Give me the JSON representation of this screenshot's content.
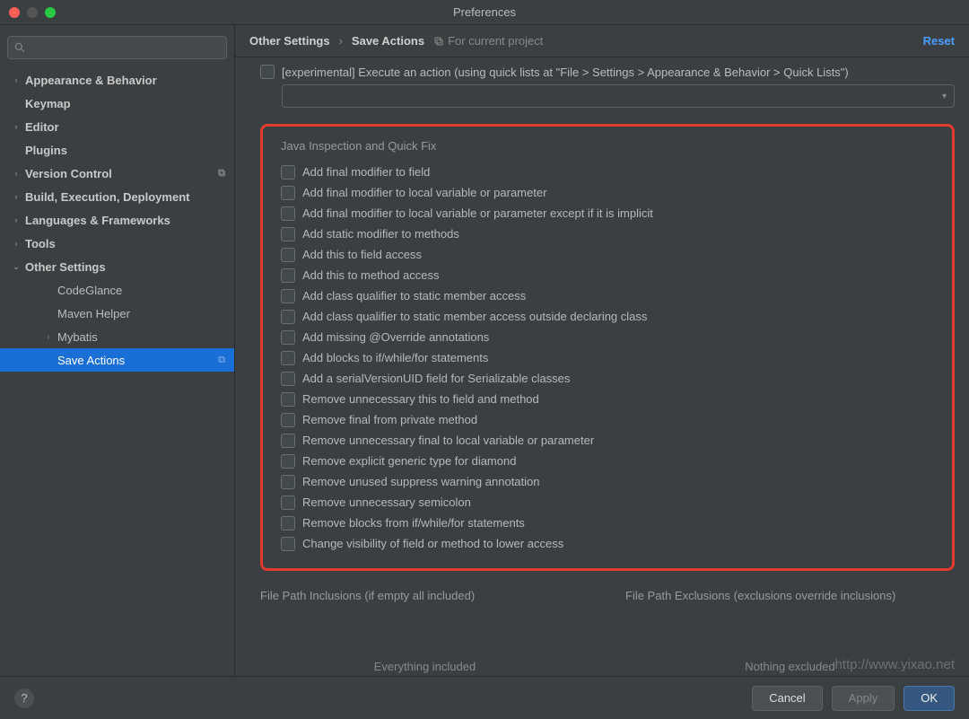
{
  "window": {
    "title": "Preferences"
  },
  "search": {
    "placeholder": ""
  },
  "sidebar": {
    "items": [
      {
        "label": "Appearance & Behavior",
        "bold": true,
        "chev": "›"
      },
      {
        "label": "Keymap",
        "bold": true,
        "chev": ""
      },
      {
        "label": "Editor",
        "bold": true,
        "chev": "›"
      },
      {
        "label": "Plugins",
        "bold": true,
        "chev": ""
      },
      {
        "label": "Version Control",
        "bold": true,
        "chev": "›",
        "proj": true
      },
      {
        "label": "Build, Execution, Deployment",
        "bold": true,
        "chev": "›"
      },
      {
        "label": "Languages & Frameworks",
        "bold": true,
        "chev": "›"
      },
      {
        "label": "Tools",
        "bold": true,
        "chev": "›"
      },
      {
        "label": "Other Settings",
        "bold": true,
        "chev": "⌄"
      },
      {
        "label": "CodeGlance",
        "indent": 2
      },
      {
        "label": "Maven Helper",
        "indent": 2
      },
      {
        "label": "Mybatis",
        "indent": 2,
        "chev": "›"
      },
      {
        "label": "Save Actions",
        "indent": 2,
        "selected": true,
        "proj": true
      }
    ]
  },
  "breadcrumb": {
    "a": "Other Settings",
    "sep": "›",
    "b": "Save Actions",
    "for_project": "For current project",
    "reset": "Reset"
  },
  "experimental": {
    "label": "[experimental] Execute an action (using quick lists at \"File > Settings > Appearance & Behavior > Quick Lists\")"
  },
  "group": {
    "title": "Java Inspection and Quick Fix",
    "options": [
      "Add final modifier to field",
      "Add final modifier to local variable or parameter",
      "Add final modifier to local variable or parameter except if it is implicit",
      "Add static modifier to methods",
      "Add this to field access",
      "Add this to method access",
      "Add class qualifier to static member access",
      "Add class qualifier to static member access outside declaring class",
      "Add missing @Override annotations",
      "Add blocks to if/while/for statements",
      "Add a serialVersionUID field for Serializable classes",
      "Remove unnecessary this to field and method",
      "Remove final from private method",
      "Remove unnecessary final to local variable or parameter",
      "Remove explicit generic type for diamond",
      "Remove unused suppress warning annotation",
      "Remove unnecessary semicolon",
      "Remove blocks from if/while/for statements",
      "Change visibility of field or method to lower access"
    ]
  },
  "inclusions": {
    "left_title": "File Path Inclusions (if empty all included)",
    "right_title": "File Path Exclusions (exclusions override inclusions)",
    "left_empty": "Everything included",
    "right_empty": "Nothing excluded"
  },
  "footer": {
    "cancel": "Cancel",
    "apply": "Apply",
    "ok": "OK"
  },
  "watermark": "http://www.yixao.net"
}
